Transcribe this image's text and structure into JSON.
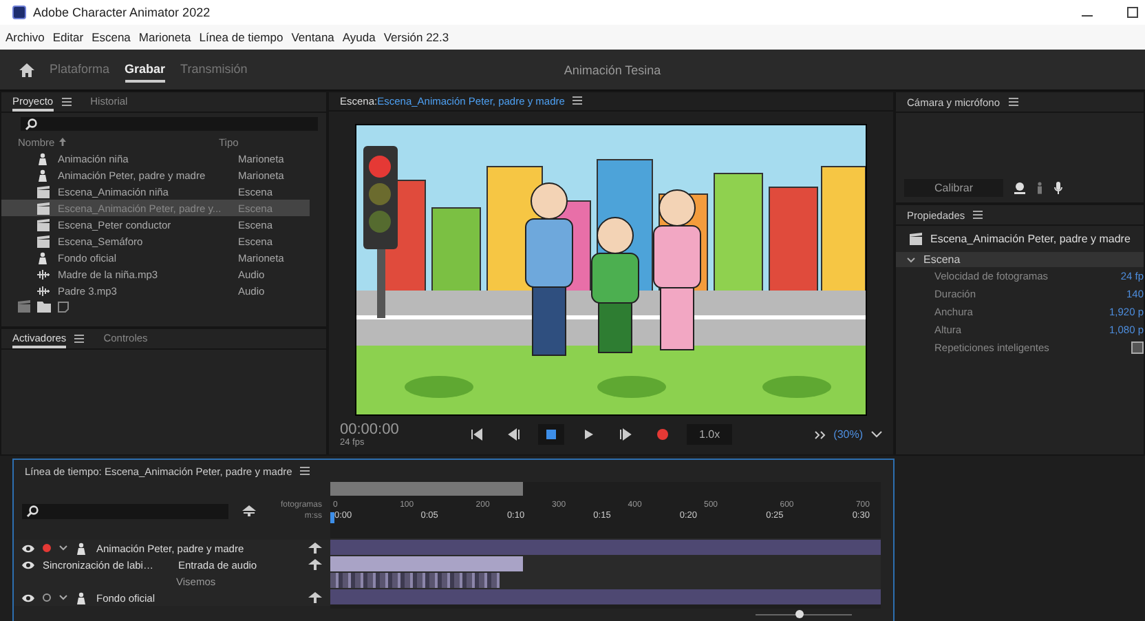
{
  "window": {
    "title": "Adobe Character Animator 2022"
  },
  "menu": [
    "Archivo",
    "Editar",
    "Escena",
    "Marioneta",
    "Línea de tiempo",
    "Ventana",
    "Ayuda",
    "Versión 22.3"
  ],
  "workspace_tabs": [
    {
      "label": "Plataforma",
      "selected": false
    },
    {
      "label": "Grabar",
      "selected": true
    },
    {
      "label": "Transmisión",
      "selected": false
    }
  ],
  "project_name": "Animación Tesina",
  "project_panel": {
    "tabs": [
      {
        "label": "Proyecto",
        "selected": true
      },
      {
        "label": "Historial",
        "selected": false
      }
    ],
    "columns": [
      "Nombre",
      "Tipo"
    ],
    "items": [
      {
        "kind": "puppet",
        "name": "Animación niña",
        "type": "Marioneta",
        "selected": false
      },
      {
        "kind": "puppet",
        "name": "Animación Peter, padre y madre",
        "type": "Marioneta",
        "selected": false
      },
      {
        "kind": "scene",
        "name": "Escena_Animación niña",
        "type": "Escena",
        "selected": false
      },
      {
        "kind": "scene",
        "name": "Escena_Animación Peter, padre y...",
        "type": "Escena",
        "selected": true
      },
      {
        "kind": "scene",
        "name": "Escena_Peter conductor",
        "type": "Escena",
        "selected": false
      },
      {
        "kind": "scene",
        "name": "Escena_Semáforo",
        "type": "Escena",
        "selected": false
      },
      {
        "kind": "puppet",
        "name": "Fondo oficial",
        "type": "Marioneta",
        "selected": false
      },
      {
        "kind": "audio",
        "name": "Madre de la niña.mp3",
        "type": "Audio",
        "selected": false
      },
      {
        "kind": "audio",
        "name": "Padre 3.mp3",
        "type": "Audio",
        "selected": false
      }
    ]
  },
  "triggers_panel": {
    "tabs": [
      {
        "label": "Activadores",
        "selected": true
      },
      {
        "label": "Controles",
        "selected": false
      }
    ]
  },
  "scene_panel": {
    "label": "Escena:",
    "scene": "Escena_Animación Peter, padre y madre",
    "time": "00:00:00",
    "fps": "24 fps",
    "speed": "1.0x",
    "zoom": "(30%)"
  },
  "camera_panel": {
    "title": "Cámara y micrófono",
    "calibrate": "Calibrar"
  },
  "properties_panel": {
    "title": "Propiedades",
    "scene": "Escena_Animación Peter, padre y madre",
    "section": {
      "label": "Escena",
      "expanded": true
    },
    "properties": [
      {
        "kind": "value",
        "label": "Velocidad de fotogramas",
        "value": "24 fp"
      },
      {
        "kind": "value",
        "label": "Duración",
        "value": "140"
      },
      {
        "kind": "value",
        "label": "Anchura",
        "value": "1,920 p"
      },
      {
        "kind": "value",
        "label": "Altura",
        "value": "1,080 p"
      },
      {
        "kind": "checkbox",
        "label": "Repeticiones inteligentes",
        "checked": false
      }
    ]
  },
  "timeline": {
    "title": "Línea de tiempo: Escena_Animación Peter, padre y madre",
    "frames_label": "fotogramas",
    "time_label": "m:ss",
    "frame_ticks": [
      "0",
      "100",
      "200",
      "300",
      "400",
      "500",
      "600",
      "700"
    ],
    "time_ticks": [
      "0:00",
      "0:05",
      "0:10",
      "0:15",
      "0:20",
      "0:25",
      "0:30"
    ],
    "tracks": [
      {
        "kind": "puppet",
        "name": "Animación Peter, padre y madre",
        "armed": true,
        "expanded": true
      },
      {
        "kind": "lipsync",
        "name": "Sincronización de labi…",
        "input": "Entrada de audio"
      },
      {
        "kind": "visemes",
        "name": "Visemos"
      },
      {
        "kind": "puppet",
        "name": "Fondo oficial",
        "armed": false,
        "expanded": true
      }
    ],
    "zoom": {
      "level": 0.45
    }
  }
}
